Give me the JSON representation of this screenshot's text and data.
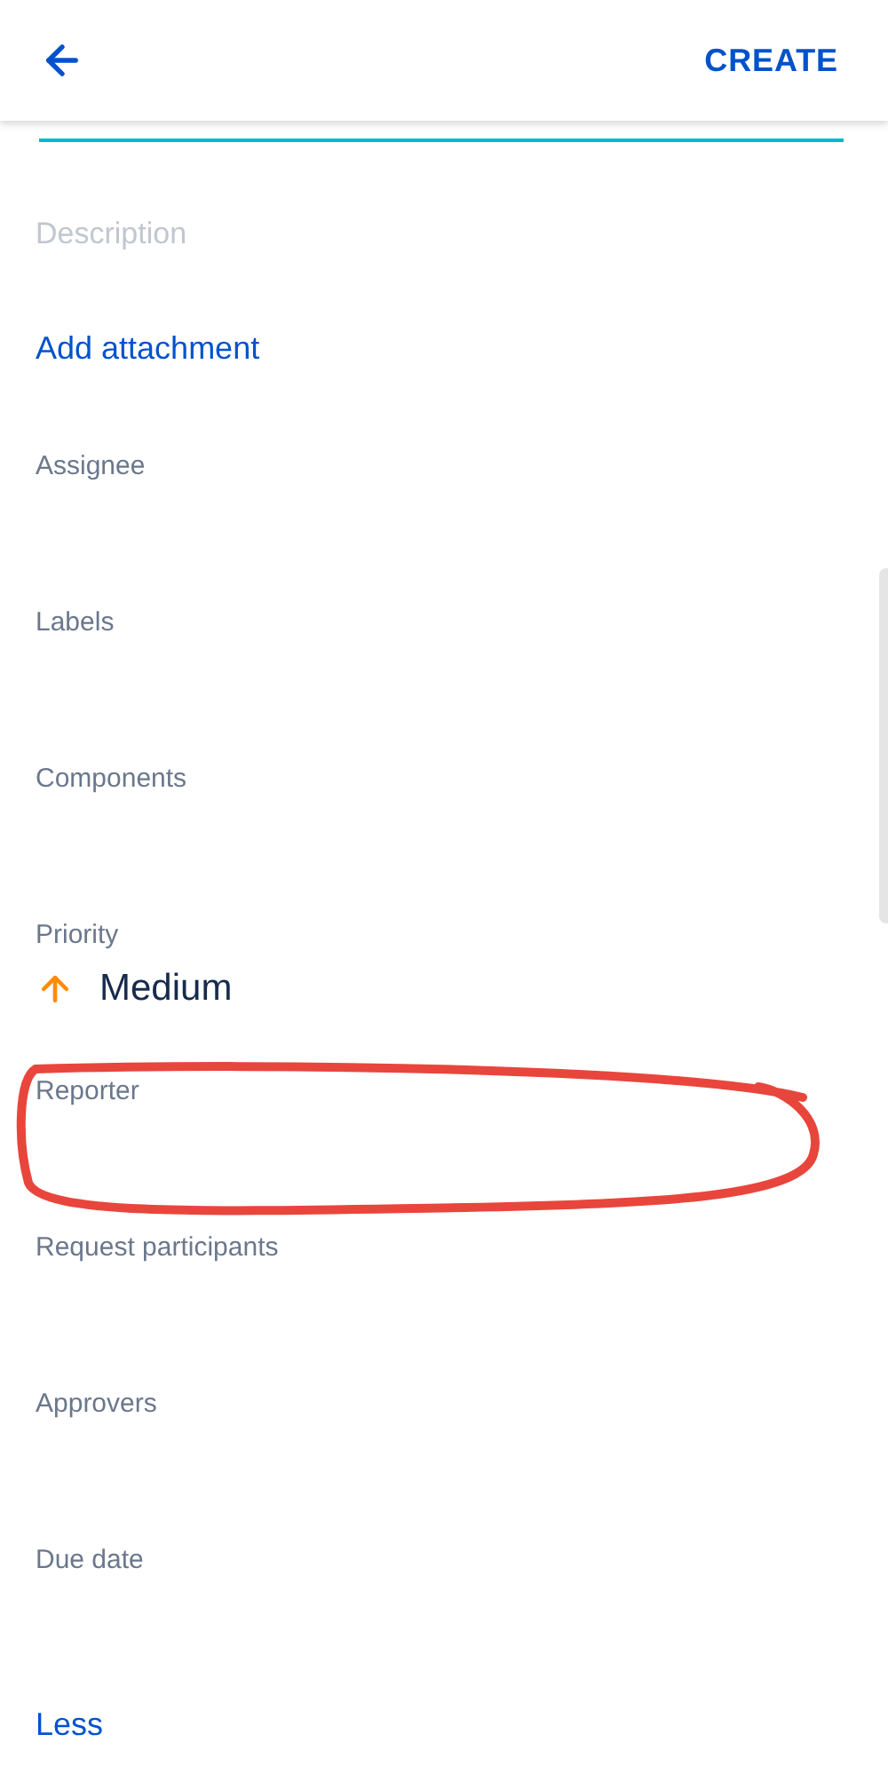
{
  "header": {
    "action": "CREATE"
  },
  "description": {
    "placeholder": "Description"
  },
  "add_attachment": "Add attachment",
  "fields": [
    {
      "label": "Assignee"
    },
    {
      "label": "Labels"
    },
    {
      "label": "Components"
    },
    {
      "label": "Priority",
      "value": "Medium"
    },
    {
      "label": "Reporter"
    },
    {
      "label": "Request participants"
    },
    {
      "label": "Approvers"
    },
    {
      "label": "Due date"
    }
  ],
  "less": "Less"
}
